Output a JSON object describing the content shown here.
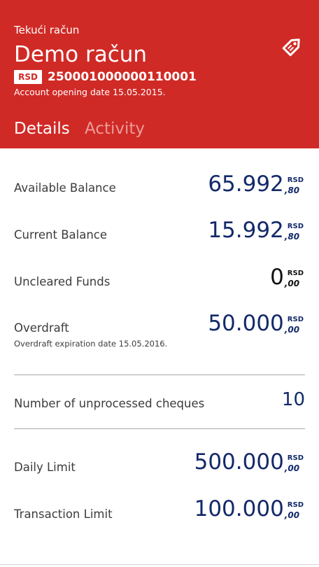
{
  "header": {
    "account_type": "Tekući račun",
    "account_name": "Demo račun",
    "currency": "RSD",
    "account_number": "250001000000110001",
    "opening_date": "Account opening date 15.05.2015.",
    "tag_icon": "price-tag-icon",
    "background_color": "#d02a26"
  },
  "tabs": [
    {
      "label": "Details",
      "active": true
    },
    {
      "label": "Activity",
      "active": false
    }
  ],
  "balances": [
    {
      "label": "Available Balance",
      "integer": "65.992",
      "decimal": "80",
      "currency": "RSD"
    },
    {
      "label": "Current Balance",
      "integer": "15.992",
      "decimal": "80",
      "currency": "RSD"
    },
    {
      "label": "Uncleared Funds",
      "integer": "0",
      "decimal": "00",
      "currency": "RSD"
    },
    {
      "label": "Overdraft",
      "integer": "50.000",
      "decimal": "00",
      "currency": "RSD",
      "note": "Overdraft expiration date 15.05.2016."
    }
  ],
  "cheques": {
    "label": "Number of unprocessed cheques",
    "value": "10"
  },
  "limits": [
    {
      "label": "Daily Limit",
      "integer": "500.000",
      "decimal": "00",
      "currency": "RSD"
    },
    {
      "label": "Transaction Limit",
      "integer": "100.000",
      "decimal": "00",
      "currency": "RSD"
    }
  ],
  "colors": {
    "accent": "#d02a26",
    "amount": "#13296a"
  }
}
